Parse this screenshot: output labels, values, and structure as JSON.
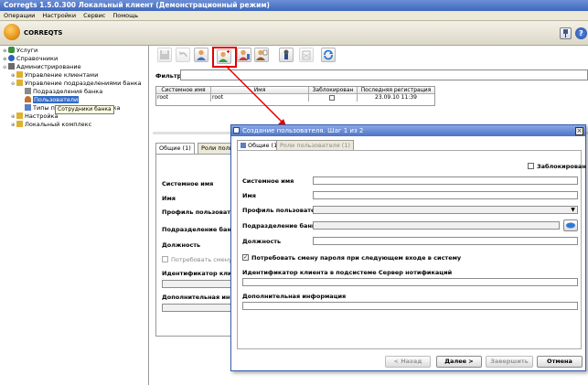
{
  "window": {
    "title": "Corregts 1.5.0.300 Локальный клиент  (Демонстрационный режим)"
  },
  "menu": [
    "Операции",
    "Настройки",
    "Сервис",
    "Помощь"
  ],
  "app": {
    "logo_text": "CORREQTS"
  },
  "tree": [
    {
      "label": "Услуги",
      "level": 0
    },
    {
      "label": "Справочники",
      "level": 0
    },
    {
      "label": "Администрирование",
      "level": 0
    },
    {
      "label": "Управление клиентами",
      "level": 1
    },
    {
      "label": "Управление подразделениями банка",
      "level": 1
    },
    {
      "label": "Подразделения банка",
      "level": 2
    },
    {
      "label": "Пользователи",
      "level": 2
    },
    {
      "label": "Типы подразделений банка",
      "level": 2
    },
    {
      "label": "Настройка",
      "level": 1
    },
    {
      "label": "Локальный комплекс",
      "level": 1
    }
  ],
  "tooltip": "Сотрудники банка",
  "filter": {
    "label": "Фильтр",
    "value": ""
  },
  "grid": {
    "columns": [
      "Системное имя",
      "Имя",
      "Заблокирован",
      "Последняя регистрация"
    ],
    "rows": [
      {
        "system_name": "root",
        "name": "root",
        "blocked": false,
        "last_login": "23.09.10 11:39"
      }
    ]
  },
  "bottom_panel": {
    "tabs": [
      "Общие (1)",
      "Роли пользователя"
    ],
    "labels": {
      "system_name": "Системное имя",
      "name": "Имя",
      "profile": "Профиль пользователя",
      "department": "Подразделение банка",
      "position": "Должность",
      "change_password": "Потребовать смену па",
      "client_id": "Идентификатор клиента",
      "additional": "Дополнительная информа"
    }
  },
  "dialog": {
    "title": "Создание пользователя. Шаг 1 из 2",
    "tabs": [
      "Общие (1)",
      "Роли пользователя (1)"
    ],
    "blocked_label": "Заблокирован",
    "labels": {
      "system_name": "Системное имя",
      "name": "Имя",
      "profile": "Профиль пользователя",
      "department": "Подразделение банка",
      "position": "Должность",
      "change_password": "Потребовать смену пароля при следующем входе в систему",
      "client_id": "Идентификатор клиента в подсистеме Сервер нотификаций",
      "additional": "Дополнительная информация"
    },
    "values": {
      "system_name": "",
      "name": "",
      "profile": "",
      "department": "",
      "position": "",
      "client_id": "",
      "additional": ""
    },
    "change_password_checked": true,
    "blocked_checked": false,
    "buttons": {
      "back": "< Назад",
      "next": "Далее >",
      "finish": "Завершить",
      "cancel": "Отмена"
    }
  },
  "colors": {
    "title_bar": "#3f67bd",
    "highlight": "#e00000",
    "selected": "#316ac5"
  }
}
